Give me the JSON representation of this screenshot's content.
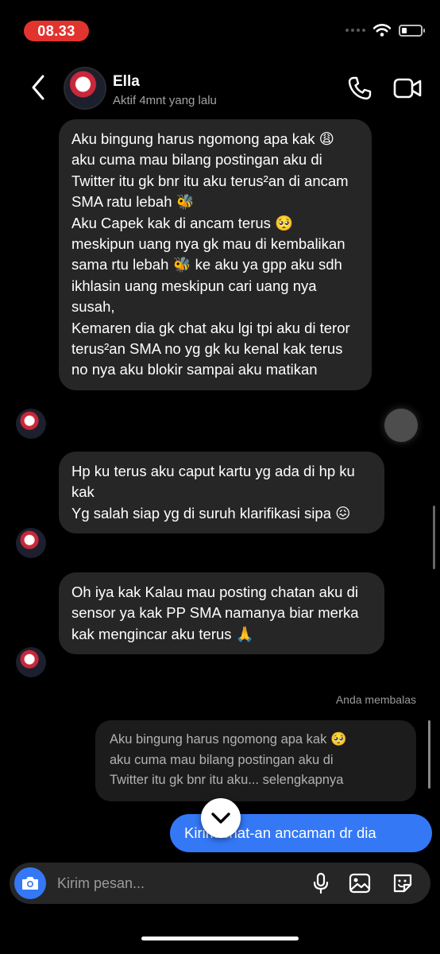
{
  "status_bar": {
    "time": "08.33"
  },
  "header": {
    "name": "Ella",
    "status": "Aktif 4mnt yang lalu"
  },
  "messages": [
    {
      "text": "Aku bingung harus ngomong apa kak 😩 aku cuma mau bilang postingan aku di Twitter itu gk bnr itu aku terus²an di ancam SMA ratu lebah 🐝\nAku Capek kak di ancam terus 🥺 meskipun uang nya gk mau di kembalikan  sama rtu lebah 🐝 ke aku  ya gpp aku sdh ikhlasin uang meskipun cari uang nya susah,\nKemaren dia gk chat aku lgi tpi aku di teror terus²an SMA no yg gk ku kenal kak terus no nya aku blokir sampai aku matikan"
    },
    {
      "text": "Hp ku   terus aku caput kartu  yg ada di hp ku kak\n Yg salah siap yg di suruh klarifikasi sipa 😖"
    },
    {
      "text": "Oh iya kak Kalau mau posting chatan aku di sensor ya kak PP SMA namanya biar merka kak  mengincar aku terus 🙏"
    }
  ],
  "reply": {
    "label": "Anda membalas",
    "quote": "Aku bingung harus ngomong apa kak 🥺\naku cuma mau bilang postingan aku di\nTwitter itu gk bnr itu aku... selengkapnya"
  },
  "sent_message": {
    "text": "Kirim chat-an ancaman dr dia"
  },
  "composer": {
    "placeholder": "Kirim pesan..."
  },
  "colors": {
    "accent": "#3478f6",
    "bubble": "#262626",
    "time_pill": "#e2342f"
  }
}
